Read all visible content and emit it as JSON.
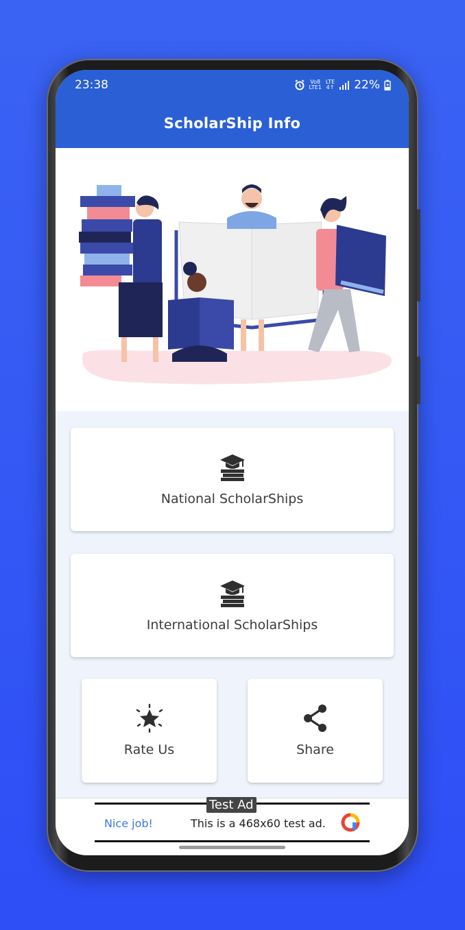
{
  "status_bar": {
    "time": "23:38",
    "network_top": "Vo8",
    "network_bottom": "LTE1",
    "lte_top": "LTE",
    "lte_bottom": "4↑",
    "battery": "22%"
  },
  "app_bar": {
    "title": "ScholarShip Info"
  },
  "menu": {
    "national_label": "National ScholarShips",
    "international_label": "International ScholarShips",
    "rate_label": "Rate Us",
    "share_label": "Share"
  },
  "ad": {
    "tag": "Test Ad",
    "nice": "Nice job!",
    "text": "This is a 468x60 test ad."
  },
  "colors": {
    "background": "#3a63f3",
    "app_bar": "#2a5fd6",
    "content_bg": "#eef3fc",
    "icon": "#2f2f2f",
    "illustration_blue": "#3b4aa8",
    "illustration_pink": "#f18a95"
  },
  "icons": {
    "national": "graduation-books-icon",
    "international": "graduation-books-icon",
    "rate": "star-burst-icon",
    "share": "share-icon"
  }
}
